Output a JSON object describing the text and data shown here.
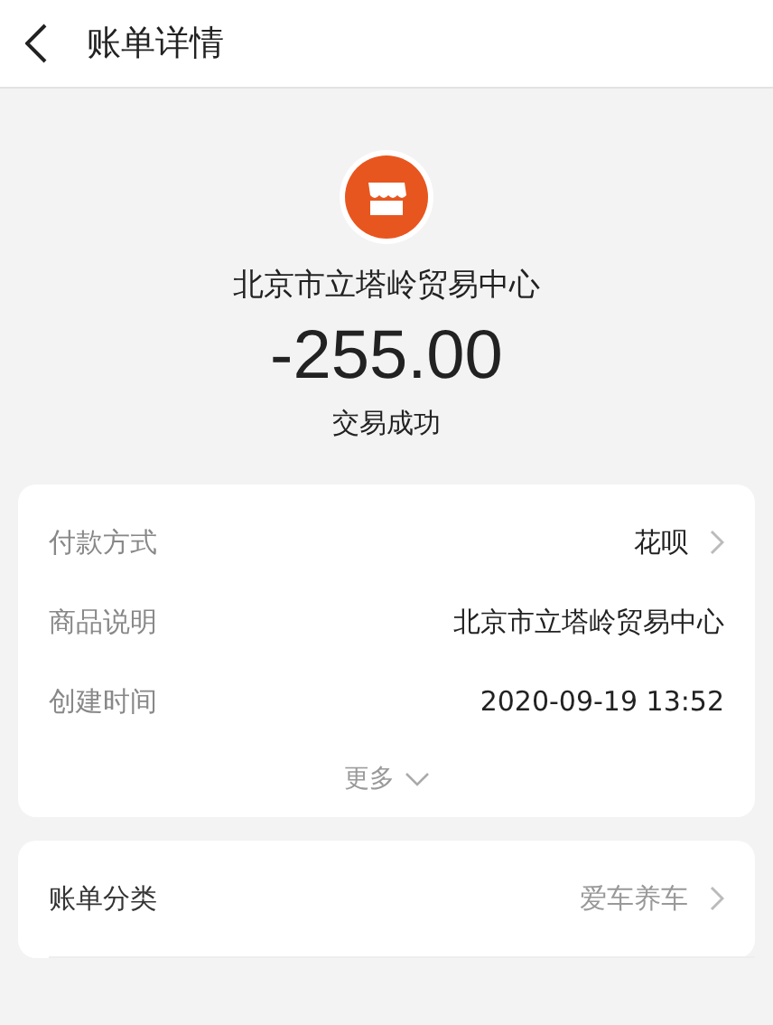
{
  "header": {
    "title": "账单详情"
  },
  "merchant": {
    "name": "北京市立塔岭贸易中心",
    "amount": "-255.00",
    "status": "交易成功"
  },
  "details": [
    {
      "label": "付款方式",
      "value": "花呗",
      "chevron": true,
      "muted": false
    },
    {
      "label": "商品说明",
      "value": "北京市立塔岭贸易中心",
      "chevron": false,
      "muted": false
    },
    {
      "label": "创建时间",
      "value": "2020-09-19 13:52",
      "chevron": false,
      "muted": false
    }
  ],
  "more": "更多",
  "category": [
    {
      "label": "账单分类",
      "value": "爱车养车",
      "chevron": true,
      "muted": true
    }
  ]
}
